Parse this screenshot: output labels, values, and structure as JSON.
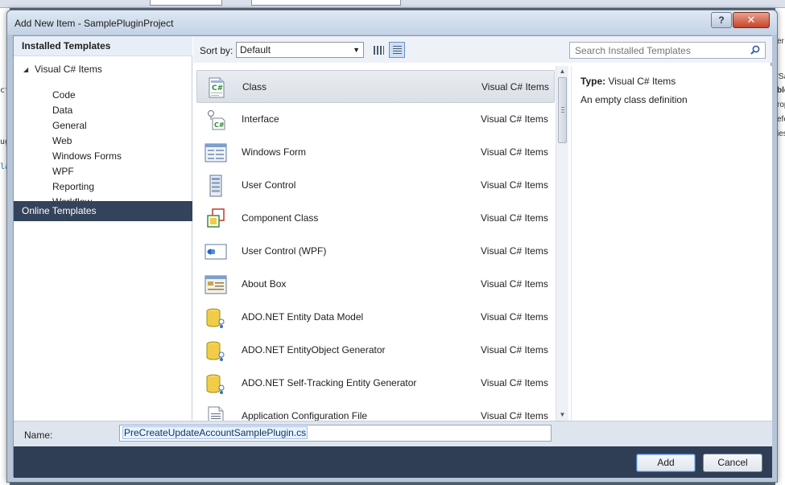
{
  "dialog": {
    "title": "Add New Item - SamplePluginProject",
    "help_glyph": "?",
    "close_glyph": "✕"
  },
  "left": {
    "installed_header": "Installed Templates",
    "tree_root": "Visual C# Items",
    "children": [
      "Code",
      "Data",
      "General",
      "Web",
      "Windows Forms",
      "WPF",
      "Reporting",
      "Workflow"
    ],
    "online_header": "Online Templates"
  },
  "toolbar": {
    "sort_label": "Sort by:",
    "sort_value": "Default",
    "search_placeholder": "Search Installed Templates"
  },
  "templates": [
    {
      "name": "Class",
      "category": "Visual C# Items",
      "icon": "csharp-class-icon",
      "selected": true
    },
    {
      "name": "Interface",
      "category": "Visual C# Items",
      "icon": "interface-icon",
      "selected": false
    },
    {
      "name": "Windows Form",
      "category": "Visual C# Items",
      "icon": "windows-form-icon",
      "selected": false
    },
    {
      "name": "User Control",
      "category": "Visual C# Items",
      "icon": "user-control-icon",
      "selected": false
    },
    {
      "name": "Component Class",
      "category": "Visual C# Items",
      "icon": "component-class-icon",
      "selected": false
    },
    {
      "name": "User Control (WPF)",
      "category": "Visual C# Items",
      "icon": "user-control-wpf-icon",
      "selected": false
    },
    {
      "name": "About Box",
      "category": "Visual C# Items",
      "icon": "about-box-icon",
      "selected": false
    },
    {
      "name": "ADO.NET Entity Data Model",
      "category": "Visual C# Items",
      "icon": "entity-data-model-icon",
      "selected": false
    },
    {
      "name": "ADO.NET EntityObject Generator",
      "category": "Visual C# Items",
      "icon": "entity-generator-icon",
      "selected": false
    },
    {
      "name": "ADO.NET Self-Tracking Entity Generator",
      "category": "Visual C# Items",
      "icon": "self-tracking-generator-icon",
      "selected": false
    },
    {
      "name": "Application Configuration File",
      "category": "Visual C# Items",
      "icon": "config-file-icon",
      "selected": false
    }
  ],
  "details": {
    "type_label": "Type:",
    "type_value": "Visual C# Items",
    "description": "An empty class definition"
  },
  "name_field": {
    "label": "Name:",
    "value": "PreCreateUpdateAccountSamplePlugin.cs"
  },
  "buttons": {
    "add": "Add",
    "cancel": "Cancel"
  },
  "background_ide": {
    "left_fragments": [
      "ct",
      "ug",
      "la"
    ],
    "right_fragments": [
      "er",
      "'Sa",
      "ble",
      "rop",
      "efe",
      "ies"
    ]
  }
}
